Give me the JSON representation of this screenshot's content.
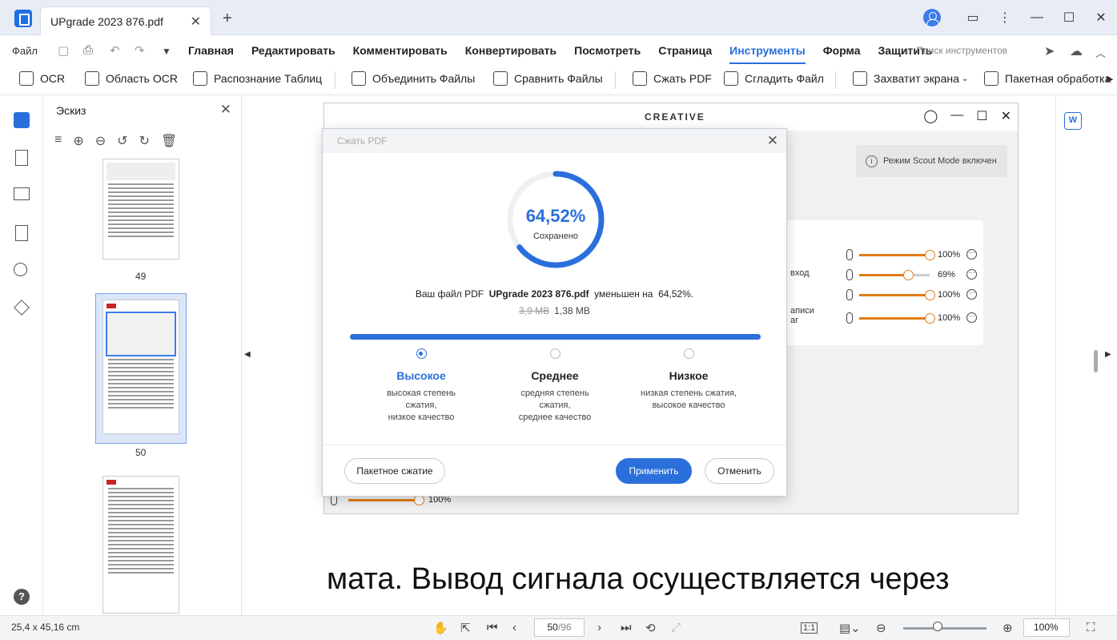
{
  "window": {
    "tab_title": "UPgrade 2023 876.pdf",
    "tab_close": "✕",
    "tab_add": "+"
  },
  "menubar": {
    "file": "Файл",
    "items": [
      "Главная",
      "Редактировать",
      "Комментировать",
      "Конвертировать",
      "Посмотреть",
      "Страница",
      "Инструменты",
      "Форма",
      "Защитить"
    ],
    "active_item": "Инструменты",
    "search_placeholder": "Поиск инструментов"
  },
  "toolbar": {
    "ocr": "OCR",
    "ocr_area": "Область OCR",
    "table_recognition": "Распознание Таблиц",
    "merge_files": "Объединить Файлы",
    "compare_files": "Сравнить Файлы",
    "compress_pdf": "Сжать PDF",
    "flatten_file": "Сгладить Файл",
    "capture_screen": "Захватит экрана",
    "batch_processing": "Пакетная обработка"
  },
  "thumbnails": {
    "title": "Эскиз",
    "close": "✕",
    "pages": [
      "49",
      "50"
    ]
  },
  "document": {
    "app_logo_text": "CREATIVE",
    "scout_mode": "Режим Scout Mode включен",
    "mixer_rows": [
      {
        "label": "",
        "percent": "100%",
        "level": 1.0
      },
      {
        "label": "вход",
        "percent": "69%",
        "level": 0.69
      },
      {
        "label": "",
        "percent": "100%",
        "level": 1.0
      },
      {
        "label": "аписи\nar",
        "percent": "100%",
        "level": 1.0
      }
    ],
    "bottom_percent": "100%",
    "big_text": "мата. Вывод сигнала осуществляется через"
  },
  "dialog": {
    "title": "Сжать PDF",
    "close": "✕",
    "percent": "64,52%",
    "percent_value": 0.6452,
    "saved_label": "Сохранено",
    "msg_prefix": "Ваш файл PDF",
    "file_name": "UPgrade 2023 876.pdf",
    "msg_mid": "уменьшен на",
    "msg_value": "64,52%.",
    "old_size": "3,9 MB",
    "new_size": "1,38 MB",
    "options": [
      {
        "title": "Высокое",
        "desc": [
          "высокая степень",
          "сжатия,",
          "низкое качество"
        ],
        "selected": true
      },
      {
        "title": "Среднее",
        "desc": [
          "средняя степень",
          "сжатия,",
          "среднее качество"
        ],
        "selected": false
      },
      {
        "title": "Низкое",
        "desc": [
          "низкая степень сжатия,",
          "высокое качество"
        ],
        "selected": false
      }
    ],
    "batch_button": "Пакетное сжатие",
    "apply_button": "Применить",
    "cancel_button": "Отменить"
  },
  "statusbar": {
    "dimensions": "25,4 x 45,16 cm",
    "current_page": "50",
    "total_pages": "/96",
    "fit_label": "1:1",
    "zoom": "100%",
    "zoom_level": 0.37
  },
  "colors": {
    "accent": "#2a6fdb",
    "slider_orange": "#e07c13"
  }
}
